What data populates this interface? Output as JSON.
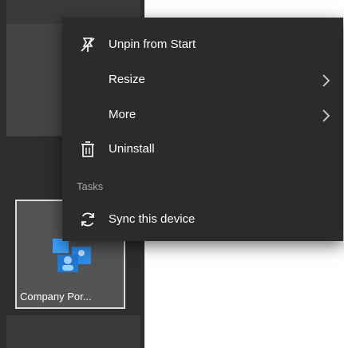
{
  "start_menu": {
    "tiles": [
      {
        "label": "Company Por...",
        "icon": "company-portal-icon"
      }
    ]
  },
  "context_menu": {
    "items": [
      {
        "label": "Unpin from Start",
        "icon": "unpin-icon"
      },
      {
        "label": "Resize",
        "icon": "",
        "submenu": true
      },
      {
        "label": "More",
        "icon": "",
        "submenu": true
      },
      {
        "label": "Uninstall",
        "icon": "trash-icon"
      }
    ],
    "tasks_header": "Tasks",
    "tasks": [
      {
        "label": "Sync this device",
        "icon": "sync-icon"
      }
    ]
  },
  "colors": {
    "menu_bg": "#2b2b2b",
    "start_bg": "#2d2d2d",
    "accent_blue": "#2b8be6"
  }
}
